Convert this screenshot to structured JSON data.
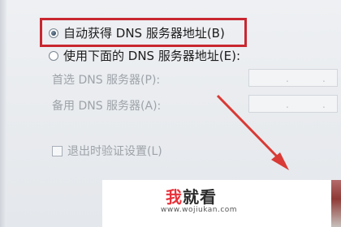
{
  "dns": {
    "auto_label": "自动获得 DNS 服务器地址(B)",
    "manual_label": "使用下面的 DNS 服务器地址(E):",
    "preferred_label": "首选 DNS 服务器(P):",
    "alternate_label": "备用 DNS 服务器(A):",
    "auto_selected": true,
    "ip_separator": "."
  },
  "validate_label": "退出时验证设置(L)",
  "watermark": {
    "mark_red": "我",
    "mark_dark": "就看",
    "url": "www.wojiukan.com"
  },
  "colors": {
    "highlight": "#c9272f",
    "arrow": "#d93a35"
  }
}
